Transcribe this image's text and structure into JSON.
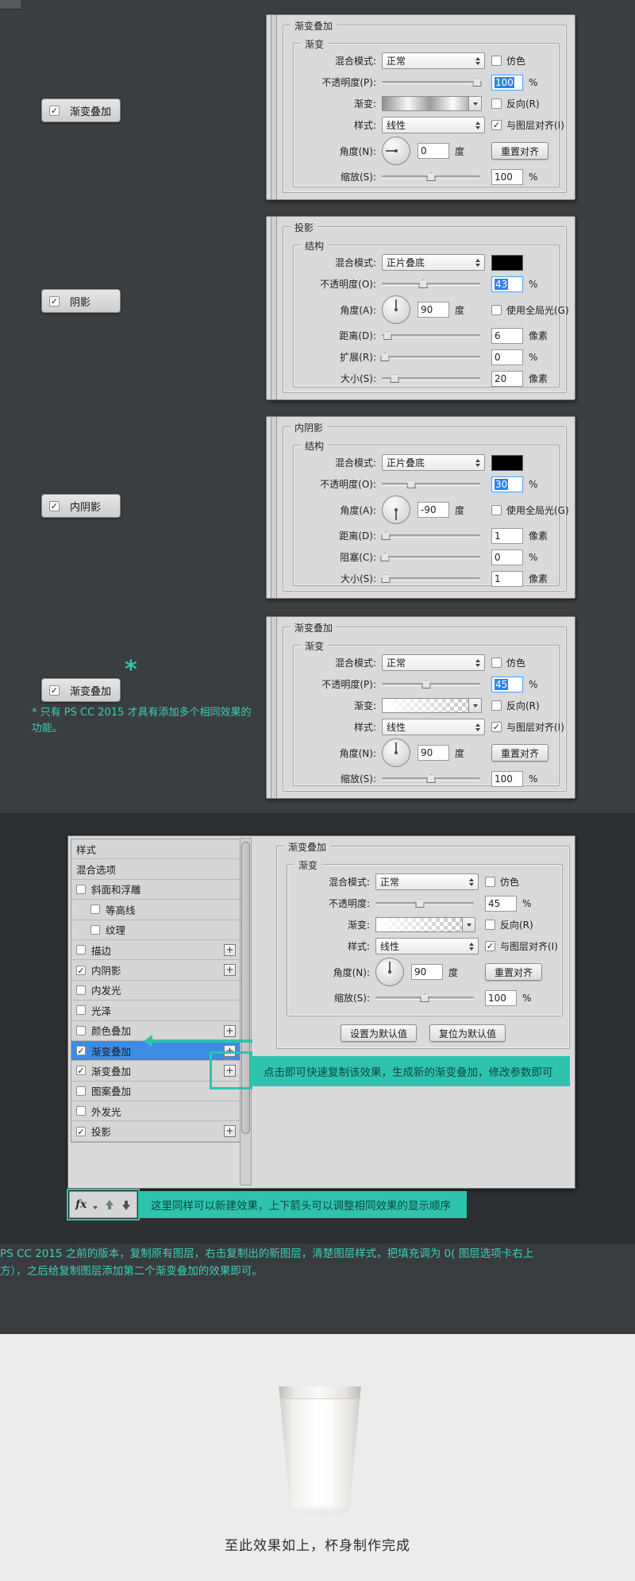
{
  "accent_color": "#2fc3ad",
  "selection_color": "#3e8ce5",
  "toggles": [
    {
      "label": "渐变叠加",
      "checked": true
    },
    {
      "label": "阴影",
      "checked": true
    },
    {
      "label": "内阴影",
      "checked": true
    },
    {
      "label": "渐变叠加",
      "checked": true
    }
  ],
  "asterisk": "*",
  "footnote": "* 只有 PS CC 2015 才具有添加多个相同效果的功能。",
  "panels": [
    {
      "title": "渐变叠加",
      "subtitle": "渐变",
      "rows": [
        {
          "type": "dropdown",
          "label": "混合模式:",
          "value": "正常",
          "right": {
            "type": "checkbox",
            "label": "仿色",
            "checked": false
          }
        },
        {
          "type": "slider",
          "label": "不透明度(P):",
          "pos": 97,
          "value": "100",
          "unit": "%",
          "selected": true
        },
        {
          "type": "gradient",
          "label": "渐变:",
          "gradient": "silver",
          "right": {
            "type": "checkbox",
            "label": "反向(R)",
            "checked": false
          }
        },
        {
          "type": "dropdown",
          "label": "样式:",
          "value": "线性",
          "right": {
            "type": "checkbox",
            "label": "与图层对齐(I)",
            "checked": true
          }
        },
        {
          "type": "dial",
          "label": "角度(N):",
          "angle": 0,
          "value": "0",
          "unit": "度",
          "right": {
            "type": "button",
            "label": "重置对齐"
          }
        },
        {
          "type": "slider",
          "label": "缩放(S):",
          "pos": 50,
          "value": "100",
          "unit": "%",
          "selected": false
        }
      ]
    },
    {
      "title": "投影",
      "subtitle": "结构",
      "rows": [
        {
          "type": "dropdown",
          "label": "混合模式:",
          "value": "正片叠底",
          "right": {
            "type": "swatch",
            "color": "#000000"
          }
        },
        {
          "type": "slider",
          "label": "不透明度(O):",
          "pos": 42,
          "value": "43",
          "unit": "%",
          "selected": true
        },
        {
          "type": "dial",
          "label": "角度(A):",
          "angle": 90,
          "value": "90",
          "unit": "度",
          "right": {
            "type": "checkbox",
            "label": "使用全局光(G)",
            "checked": false
          }
        },
        {
          "type": "slider",
          "label": "距离(D):",
          "pos": 6,
          "value": "6",
          "unit": "像素",
          "selected": false
        },
        {
          "type": "slider",
          "label": "扩展(R):",
          "pos": 3,
          "value": "0",
          "unit": "%",
          "selected": false
        },
        {
          "type": "slider",
          "label": "大小(S):",
          "pos": 13,
          "value": "20",
          "unit": "像素",
          "selected": false
        }
      ]
    },
    {
      "title": "内阴影",
      "subtitle": "结构",
      "rows": [
        {
          "type": "dropdown",
          "label": "混合模式:",
          "value": "正片叠底",
          "right": {
            "type": "swatch",
            "color": "#000000"
          }
        },
        {
          "type": "slider",
          "label": "不透明度(O):",
          "pos": 30,
          "value": "30",
          "unit": "%",
          "selected": true
        },
        {
          "type": "dial",
          "label": "角度(A):",
          "angle": -90,
          "value": "-90",
          "unit": "度",
          "right": {
            "type": "checkbox",
            "label": "使用全局光(G)",
            "checked": false
          }
        },
        {
          "type": "slider",
          "label": "距离(D):",
          "pos": 4,
          "value": "1",
          "unit": "像素",
          "selected": false
        },
        {
          "type": "slider",
          "label": "阻塞(C):",
          "pos": 3,
          "value": "0",
          "unit": "%",
          "selected": false
        },
        {
          "type": "slider",
          "label": "大小(S):",
          "pos": 4,
          "value": "1",
          "unit": "像素",
          "selected": false
        }
      ]
    },
    {
      "title": "渐变叠加",
      "subtitle": "渐变",
      "rows": [
        {
          "type": "dropdown",
          "label": "混合模式:",
          "value": "正常",
          "right": {
            "type": "checkbox",
            "label": "仿色",
            "checked": false
          }
        },
        {
          "type": "slider",
          "label": "不透明度(P):",
          "pos": 45,
          "value": "45",
          "unit": "%",
          "selected": true
        },
        {
          "type": "gradient",
          "label": "渐变:",
          "gradient": "transparent",
          "right": {
            "type": "checkbox",
            "label": "反向(R)",
            "checked": false
          }
        },
        {
          "type": "dropdown",
          "label": "样式:",
          "value": "线性",
          "right": {
            "type": "checkbox",
            "label": "与图层对齐(I)",
            "checked": true
          }
        },
        {
          "type": "dial",
          "label": "角度(N):",
          "angle": 90,
          "value": "90",
          "unit": "度",
          "right": {
            "type": "button",
            "label": "重置对齐"
          }
        },
        {
          "type": "slider",
          "label": "缩放(S):",
          "pos": 50,
          "value": "100",
          "unit": "%",
          "selected": false
        }
      ]
    }
  ],
  "dialog": {
    "list": [
      {
        "label": "样式"
      },
      {
        "label": "混合选项"
      },
      {
        "label": "斜面和浮雕",
        "checkbox": true,
        "checked": false
      },
      {
        "label": "等高线",
        "checkbox": true,
        "checked": false,
        "indent": true
      },
      {
        "label": "纹理",
        "checkbox": true,
        "checked": false,
        "indent": true
      },
      {
        "label": "描边",
        "checkbox": true,
        "checked": false,
        "plus": true
      },
      {
        "label": "内阴影",
        "checkbox": true,
        "checked": true,
        "plus": true
      },
      {
        "label": "内发光",
        "checkbox": true,
        "checked": false
      },
      {
        "label": "光泽",
        "checkbox": true,
        "checked": false
      },
      {
        "label": "颜色叠加",
        "checkbox": true,
        "checked": false,
        "plus": true
      },
      {
        "label": "渐变叠加",
        "checkbox": true,
        "checked": true,
        "plus": true,
        "selected": true
      },
      {
        "label": "渐变叠加",
        "checkbox": true,
        "checked": true,
        "plus": true
      },
      {
        "label": "图案叠加",
        "checkbox": true,
        "checked": false
      },
      {
        "label": "外发光",
        "checkbox": true,
        "checked": false
      },
      {
        "label": "投影",
        "checkbox": true,
        "checked": true,
        "plus": true
      }
    ],
    "settings": {
      "title": "渐变叠加",
      "subtitle": "渐变",
      "rows": [
        {
          "type": "dropdown",
          "label": "混合模式:",
          "value": "正常",
          "right": {
            "type": "checkbox",
            "label": "仿色",
            "checked": false
          }
        },
        {
          "type": "slider",
          "label": "不透明度:",
          "pos": 45,
          "value": "45",
          "unit": "%",
          "selected": false
        },
        {
          "type": "gradient",
          "label": "渐变:",
          "gradient": "transparent",
          "right": {
            "type": "checkbox",
            "label": "反向(R)",
            "checked": false
          }
        },
        {
          "type": "dropdown",
          "label": "样式:",
          "value": "线性",
          "right": {
            "type": "checkbox",
            "label": "与图层对齐(I)",
            "checked": true
          }
        },
        {
          "type": "dial",
          "label": "角度(N):",
          "angle": 90,
          "value": "90",
          "unit": "度",
          "right": {
            "type": "button",
            "label": "重置对齐"
          }
        },
        {
          "type": "slider",
          "label": "缩放(S):",
          "pos": 50,
          "value": "100",
          "unit": "%",
          "selected": false
        }
      ],
      "buttons": [
        "设置为默认值",
        "复位为默认值"
      ]
    },
    "annotation_copy": "点击即可快速复制该效果，生成新的渐变叠加，修改参数即可",
    "annotation_fx": "这里同样可以新建效果，上下箭头可以调整相同效果的显示顺序",
    "fx_label": "fx"
  },
  "paragraph": "PS CC 2015 之前的版本，复制原有图层，右击复制出的新图层，清楚图层样式，把填充调为 0( 图层选项卡右上方），之后给复制图层添加第二个渐变叠加的效果即可。",
  "footer_caption": "至此效果如上，杯身制作完成"
}
